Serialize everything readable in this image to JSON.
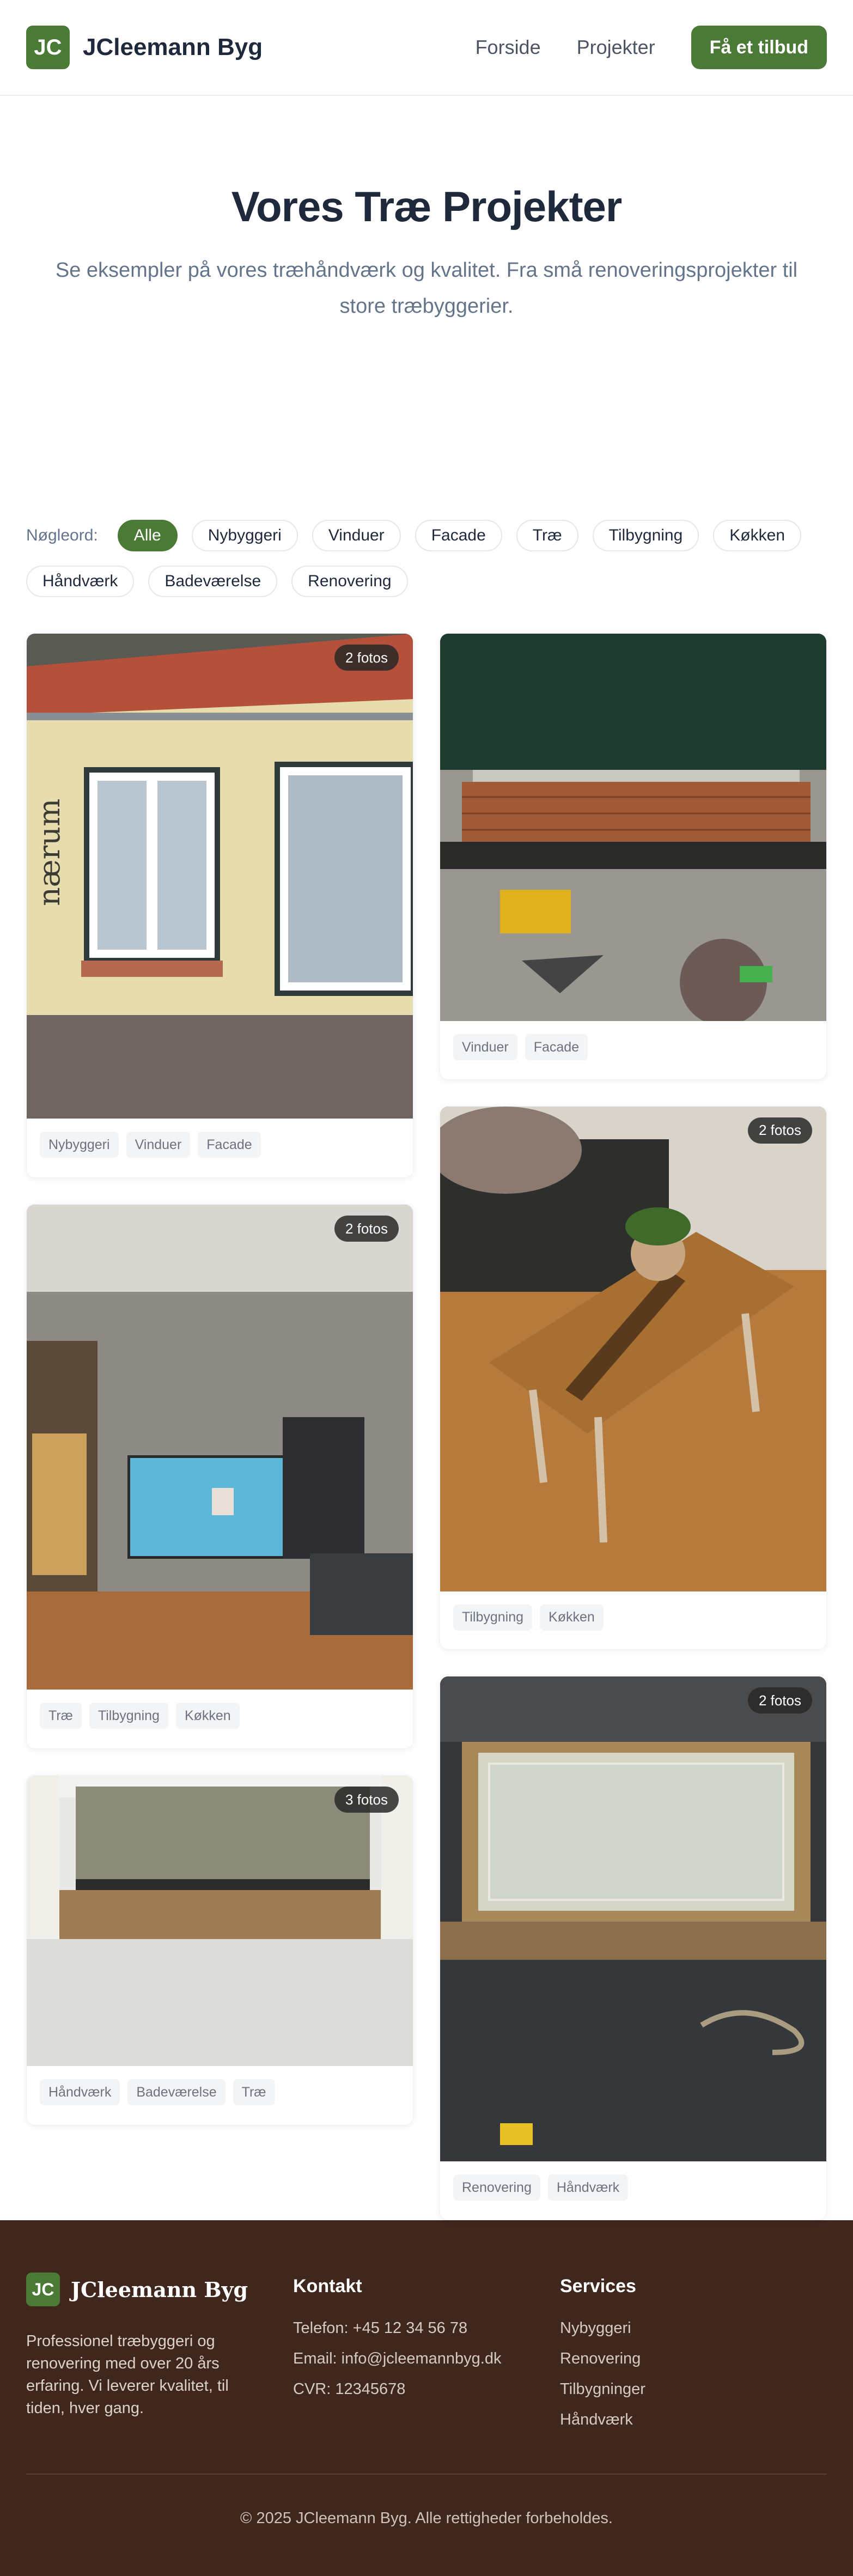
{
  "header": {
    "logo_text": "JC",
    "brand": "JCleemann Byg",
    "nav": [
      "Forside",
      "Projekter"
    ],
    "cta": "Få et tilbud"
  },
  "hero": {
    "title": "Vores Træ Projekter",
    "subtitle": "Se eksempler på vores træhåndværk og kvalitet. Fra små renoveringsprojekter til store træbyggerier."
  },
  "filters": {
    "label": "Nøgleord:",
    "chips": [
      "Alle",
      "Nybyggeri",
      "Vinduer",
      "Facade",
      "Træ",
      "Tilbygning",
      "Køkken",
      "Håndværk",
      "Badeværelse",
      "Renovering"
    ],
    "active": "Alle"
  },
  "projects": {
    "p1": {
      "badge": "2 fotos",
      "tags": [
        "Nybyggeri",
        "Vinduer",
        "Facade"
      ]
    },
    "p2": {
      "tags": [
        "Vinduer",
        "Facade"
      ]
    },
    "p3": {
      "badge": "2 fotos",
      "tags": [
        "Træ",
        "Tilbygning",
        "Køkken"
      ]
    },
    "p4": {
      "badge": "2 fotos",
      "tags": [
        "Tilbygning",
        "Køkken"
      ]
    },
    "p5": {
      "badge": "3 fotos",
      "tags": [
        "Håndværk",
        "Badeværelse",
        "Træ"
      ]
    },
    "p6": {
      "badge": "2 fotos",
      "tags": [
        "Renovering",
        "Håndværk"
      ]
    }
  },
  "footer": {
    "logo_text": "JC",
    "brand": "JCleemann Byg",
    "description": "Professionel træbyggeri og renovering med over 20 års erfaring. Vi leverer kvalitet, til tiden, hver gang.",
    "contact_heading": "Kontakt",
    "contact": [
      "Telefon: +45 12 34 56 78",
      "Email: info@jcleemannbyg.dk",
      "CVR: 12345678"
    ],
    "services_heading": "Services",
    "services": [
      "Nybyggeri",
      "Renovering",
      "Tilbygninger",
      "Håndværk"
    ],
    "copyright": "© 2025 JCleemann Byg. Alle rettigheder forbeholdes."
  },
  "colors": {
    "brand_green": "#4a7a36",
    "footer_brown": "#3f271e",
    "heading": "#1e293b"
  }
}
